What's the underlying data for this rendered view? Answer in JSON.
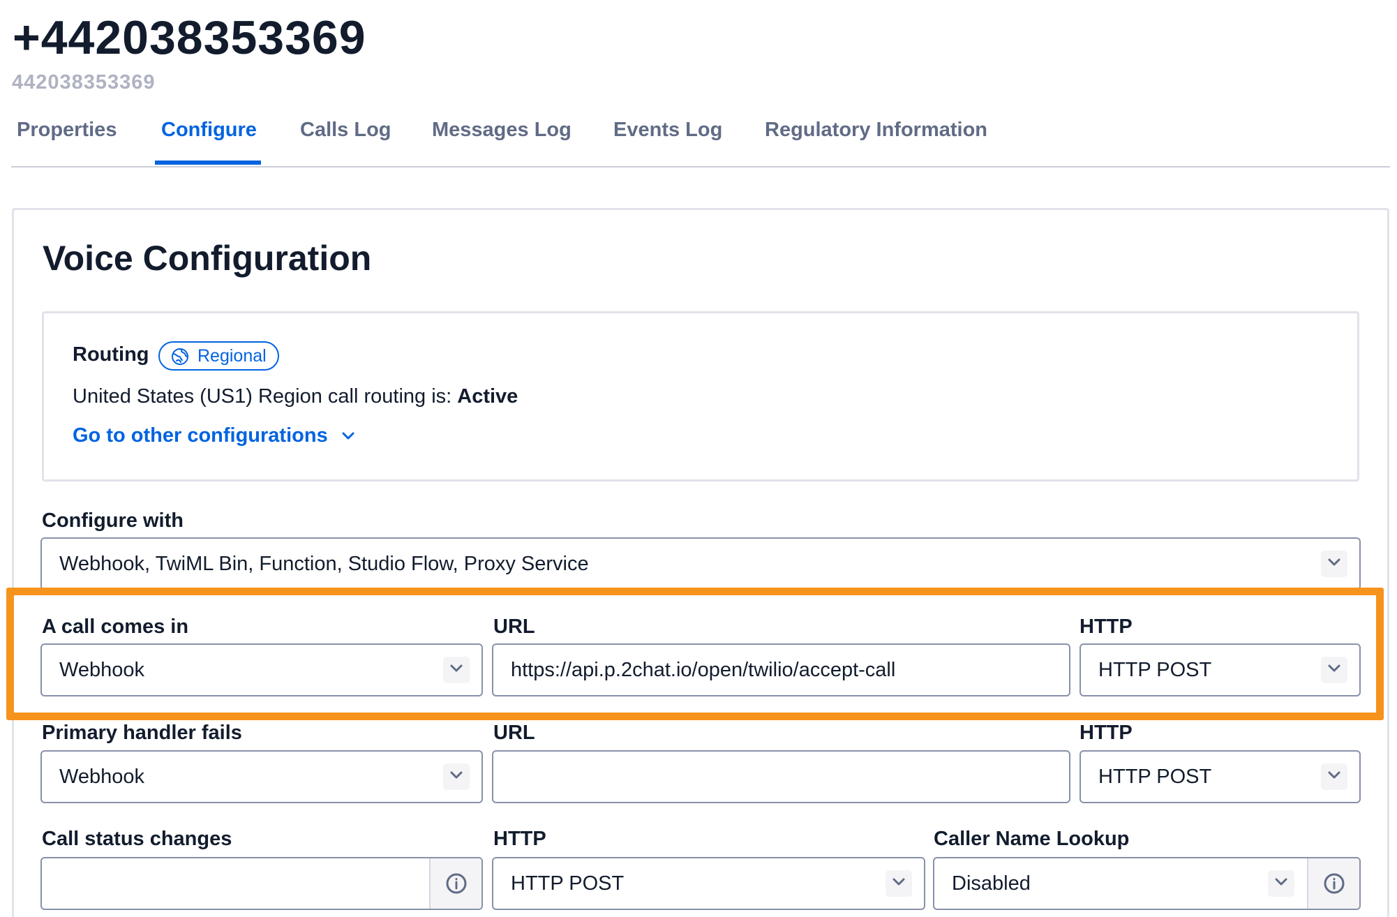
{
  "header": {
    "phone_number": "+442038353369",
    "phone_number_sid": "442038353369"
  },
  "tabs": [
    {
      "label": "Properties",
      "active": false
    },
    {
      "label": "Configure",
      "active": true
    },
    {
      "label": "Calls Log",
      "active": false
    },
    {
      "label": "Messages Log",
      "active": false
    },
    {
      "label": "Events Log",
      "active": false
    },
    {
      "label": "Regulatory Information",
      "active": false
    }
  ],
  "voice": {
    "title": "Voice Configuration",
    "routing": {
      "label": "Routing",
      "badge": "Regional",
      "status_prefix": "United States (US1) Region call routing is: ",
      "status_value": "Active",
      "other_configurations": "Go to other configurations"
    },
    "configure_with": {
      "label": "Configure with",
      "value": "Webhook, TwiML Bin, Function, Studio Flow, Proxy Service"
    },
    "call_comes_in": {
      "label": "A call comes in",
      "type": "Webhook",
      "url_label": "URL",
      "url": "https://api.p.2chat.io/open/twilio/accept-call",
      "http_label": "HTTP",
      "http": "HTTP POST"
    },
    "primary_handler_fails": {
      "label": "Primary handler fails",
      "type": "Webhook",
      "url_label": "URL",
      "url": "",
      "http_label": "HTTP",
      "http": "HTTP POST"
    },
    "call_status_changes": {
      "label": "Call status changes",
      "url": "",
      "http_label": "HTTP",
      "http": "HTTP POST"
    },
    "caller_name_lookup": {
      "label": "Caller Name Lookup",
      "value": "Disabled"
    }
  },
  "icons": {
    "regional": "globe-icon",
    "expand": "chevron-down-icon",
    "info": "info-icon"
  },
  "colors": {
    "accent": "#0263e0",
    "text": "#121c2d",
    "highlight": "#f6931d"
  }
}
